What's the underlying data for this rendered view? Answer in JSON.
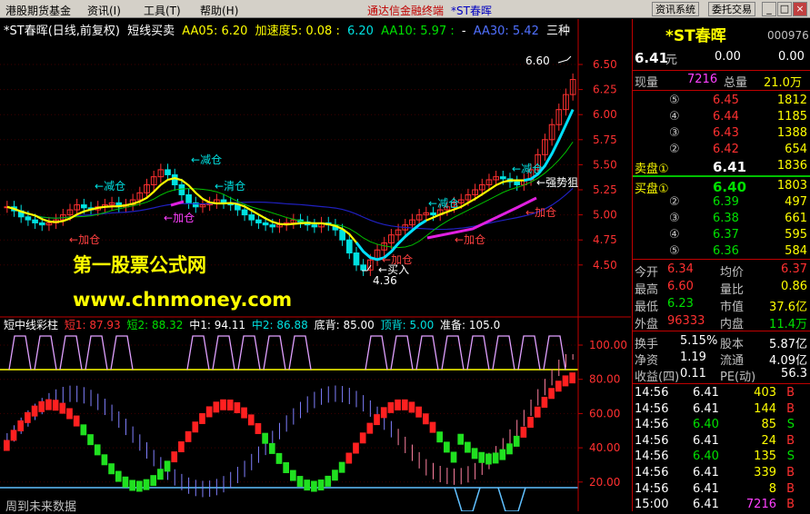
{
  "menubar": {
    "items": [
      "港股期货基金",
      "资讯(I)",
      "工具(T)",
      "帮助(H)"
    ],
    "center_app": "通达信金融终端",
    "center_stock": "*ST春晖",
    "btn1": "资讯系统",
    "btn2": "委托交易",
    "win_min": "_",
    "win_max": "□",
    "win_close": "×"
  },
  "chart_header": {
    "name": "*ST春晖(日线,前复权)",
    "formula": "短线买卖",
    "aa05": "AA05: 6.20",
    "jsd": "加速度5: 0.08 :",
    "v620": "6.20",
    "aa10": "AA10: 5.97 :",
    "dash": "-",
    "aa30": "AA30: 5.42",
    "san": "三种"
  },
  "price_axis": [
    "6.50",
    "6.25",
    "6.00",
    "5.75",
    "5.50",
    "5.25",
    "5.00",
    "4.75",
    "4.50"
  ],
  "ind_axis": [
    "100.00",
    "80.00",
    "60.00",
    "40.00",
    "20.00"
  ],
  "annotations": {
    "high": "6.60",
    "low": "4.36",
    "jian1": "减仓",
    "jian2": "减仓",
    "jian3": "减仓",
    "jian4": "减仓",
    "qing": "清仓",
    "jia1": "加仓",
    "jia2": "加仓",
    "jia3": "加仓",
    "jia4": "加仓",
    "jia5": "加仓",
    "buy": "买入",
    "strong": "强势狙击"
  },
  "watermark": {
    "line1": "第一股票公式网",
    "line2": "www.chnmoney.com"
  },
  "indicator_header": {
    "name": "短中线彩柱",
    "d1": "短1: 87.93",
    "d2": "短2: 88.32",
    "z1": "中1: 94.11",
    "z2": "中2: 86.88",
    "db": "底背: 85.00",
    "dd": "顶背: 5.00",
    "zb": "准备: 105.0"
  },
  "footer": "周到未来数据",
  "panel": {
    "name": "*ST春晖",
    "code": "000976",
    "price": "6.41",
    "yuan": "元",
    "chg": "0.00",
    "pct": "0.00",
    "xianliang": "现量",
    "xianliang_v": "7216",
    "zongliang": "总量",
    "zongliang_v": "21.0万",
    "sell": [
      {
        "label": "⑤",
        "price": "6.45",
        "vol": "1812"
      },
      {
        "label": "④",
        "price": "6.44",
        "vol": "1185"
      },
      {
        "label": "③",
        "price": "6.43",
        "vol": "1388"
      },
      {
        "label": "②",
        "price": "6.42",
        "vol": "654"
      },
      {
        "label": "卖盘①",
        "price": "6.41",
        "vol": "1836"
      }
    ],
    "buy": [
      {
        "label": "买盘①",
        "price": "6.40",
        "vol": "1803"
      },
      {
        "label": "②",
        "price": "6.39",
        "vol": "497"
      },
      {
        "label": "③",
        "price": "6.38",
        "vol": "661"
      },
      {
        "label": "④",
        "price": "6.37",
        "vol": "595"
      },
      {
        "label": "⑤",
        "price": "6.36",
        "vol": "584"
      }
    ],
    "stats": [
      {
        "k1": "今开",
        "v1": "6.34",
        "k2": "均价",
        "v2": "6.37"
      },
      {
        "k1": "最高",
        "v1": "6.60",
        "k2": "量比",
        "v2": "0.86"
      },
      {
        "k1": "最低",
        "v1": "6.23",
        "k2": "市值",
        "v2": "37.6亿"
      },
      {
        "k1": "外盘",
        "v1": "96333",
        "k2": "内盘",
        "v2": "11.4万"
      }
    ],
    "fin": [
      {
        "k1": "换手",
        "v1": "5.15%",
        "k2": "股本",
        "v2": "5.87亿"
      },
      {
        "k1": "净资",
        "v1": "1.19",
        "k2": "流通",
        "v2": "4.09亿"
      },
      {
        "k1": "收益(四)",
        "v1": "0.11",
        "k2": "PE(动)",
        "v2": "56.3"
      }
    ],
    "ticks": [
      {
        "t": "14:56",
        "p": "6.41",
        "v": "403",
        "s": "B"
      },
      {
        "t": "14:56",
        "p": "6.41",
        "v": "144",
        "s": "B"
      },
      {
        "t": "14:56",
        "p": "6.40",
        "v": "85",
        "s": "S"
      },
      {
        "t": "14:56",
        "p": "6.41",
        "v": "24",
        "s": "B"
      },
      {
        "t": "14:56",
        "p": "6.40",
        "v": "135",
        "s": "S"
      },
      {
        "t": "14:56",
        "p": "6.41",
        "v": "339",
        "s": "B"
      },
      {
        "t": "14:56",
        "p": "6.41",
        "v": "8",
        "s": "B"
      },
      {
        "t": "15:00",
        "p": "6.41",
        "v": "7216",
        "s": "B"
      }
    ]
  }
}
